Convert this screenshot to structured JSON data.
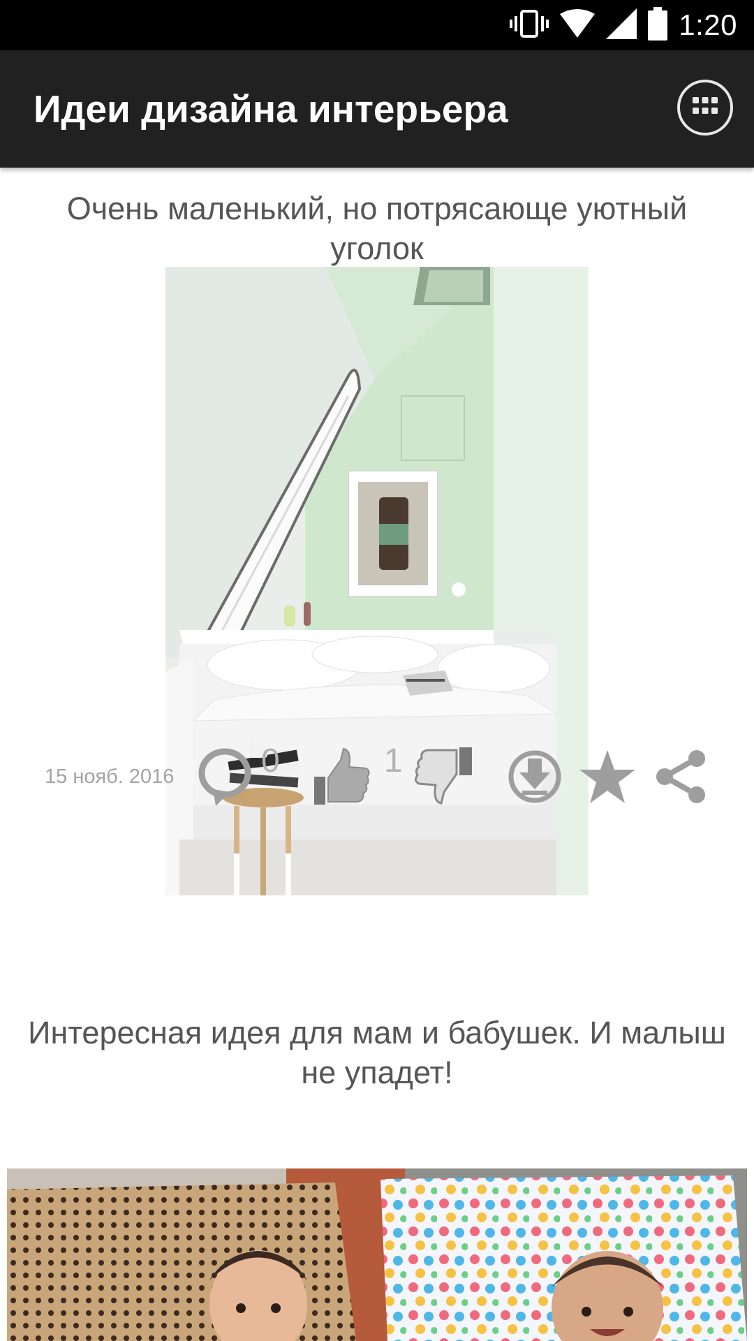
{
  "status_bar": {
    "time": "1:20",
    "icons": [
      "vibrate-icon",
      "wifi-icon",
      "signal-icon",
      "battery-icon"
    ]
  },
  "app_bar": {
    "title": "Идеи дизайна интерьера",
    "menu_icon": "apps-grid-icon"
  },
  "posts": [
    {
      "title": "Очень маленький, но потрясающе уютный уголок",
      "date": "15 нояб. 2016",
      "comments": "0",
      "likes": "1",
      "actions": [
        "comment-icon",
        "like-icon",
        "dislike-icon",
        "download-icon",
        "favorite-icon",
        "share-icon"
      ]
    },
    {
      "title": "Интересная идея для мам и бабушек. И малыш не упадет!"
    }
  ],
  "colors": {
    "status_bar": "#000000",
    "app_bar": "#212121",
    "text_gray": "#555555",
    "icon_gray": "#9e9e9e"
  }
}
